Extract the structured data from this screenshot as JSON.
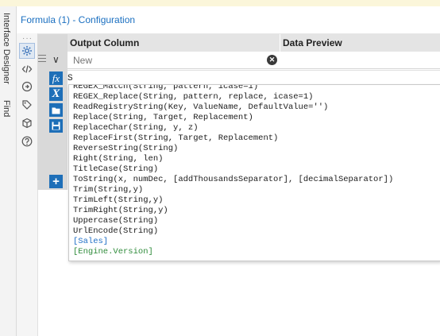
{
  "window": {
    "title": "Formula (1) - Configuration",
    "side_tabs": [
      "Interface Designer",
      "Find"
    ]
  },
  "rail": {
    "icons": [
      {
        "name": "gear-icon",
        "active": true
      },
      {
        "name": "code-icon",
        "active": false
      },
      {
        "name": "target-icon",
        "active": false
      },
      {
        "name": "tag-icon",
        "active": false
      },
      {
        "name": "cube-icon",
        "active": false
      },
      {
        "name": "help-icon",
        "active": false
      }
    ]
  },
  "grid": {
    "headers": {
      "output_column": "Output Column",
      "data_preview": "Data Preview"
    },
    "new_row": {
      "placeholder": "New",
      "value": ""
    }
  },
  "editor": {
    "expression": "S",
    "toolbar": [
      "fx",
      "X",
      "open-folder",
      "save"
    ]
  },
  "autocomplete": {
    "items": [
      {
        "text": "REGEX_Match(String, pattern, icase=1)",
        "kind": "function"
      },
      {
        "text": "REGEX_Replace(String, pattern, replace, icase=1)",
        "kind": "function"
      },
      {
        "text": "ReadRegistryString(Key, ValueName, DefaultValue='')",
        "kind": "function"
      },
      {
        "text": "Replace(String, Target, Replacement)",
        "kind": "function"
      },
      {
        "text": "ReplaceChar(String, y, z)",
        "kind": "function"
      },
      {
        "text": "ReplaceFirst(String, Target, Replacement)",
        "kind": "function"
      },
      {
        "text": "ReverseString(String)",
        "kind": "function"
      },
      {
        "text": "Right(String, len)",
        "kind": "function"
      },
      {
        "text": "TitleCase(String)",
        "kind": "function"
      },
      {
        "text": "ToString(x, numDec, [addThousandsSeparator], [decimalSeparator])",
        "kind": "function"
      },
      {
        "text": "Trim(String,y)",
        "kind": "function"
      },
      {
        "text": "TrimLeft(String,y)",
        "kind": "function"
      },
      {
        "text": "TrimRight(String,y)",
        "kind": "function"
      },
      {
        "text": "Uppercase(String)",
        "kind": "function"
      },
      {
        "text": "UrlEncode(String)",
        "kind": "function"
      },
      {
        "text": "[Sales]",
        "kind": "field"
      },
      {
        "text": "[Engine.Version]",
        "kind": "constant"
      }
    ]
  },
  "colors": {
    "accent": "#1e6fb8",
    "title_text": "#1a6fc0",
    "field": "#1f6fc6",
    "constant": "#2e8b3a"
  }
}
